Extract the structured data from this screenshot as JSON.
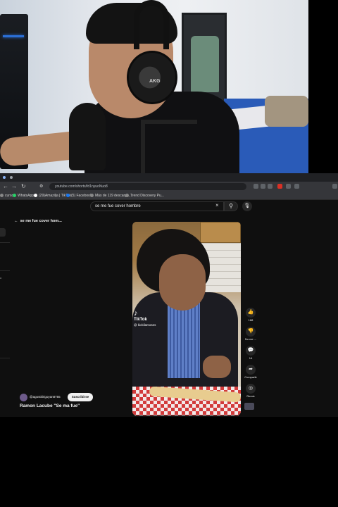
{
  "browser": {
    "url": "youtube.com/shorts/fd1nyuoNuo8",
    "bookmarks": [
      {
        "label": "cursos",
        "color": "#888888"
      },
      {
        "label": "WhatsApp",
        "color": "#25d366"
      },
      {
        "label": "(29)Amazilja | TikTok",
        "color": "#ffffff"
      },
      {
        "label": "(5) Facebook",
        "color": "#1877f2"
      },
      {
        "label": "Más de 119 descarga...",
        "color": "#888888"
      },
      {
        "label": "Trend Discovery Pu...",
        "color": "#888888"
      }
    ]
  },
  "youtube": {
    "search_value": "se me fue cover hombre",
    "back_title": "se me fue cover hom...",
    "left_edge_label": "o",
    "short": {
      "watermark": "TikTok",
      "handle": "@ kickilamoses"
    },
    "actions": [
      {
        "icon": "thumbs-up-icon",
        "glyph": "👍",
        "label": "188"
      },
      {
        "icon": "thumbs-down-icon",
        "glyph": "👎",
        "label": "No me ..."
      },
      {
        "icon": "comment-icon",
        "glyph": "💬",
        "label": "14"
      },
      {
        "icon": "share-icon",
        "glyph": "➦",
        "label": "Compartir"
      },
      {
        "icon": "remix-icon",
        "glyph": "◎",
        "label": "Remix"
      }
    ],
    "channel": {
      "name": "@agostitirigoyan8755",
      "subscribe_label": "Suscribirse"
    },
    "video_title": "Ramon Lacube \"Se ma fue\""
  },
  "webcam": {
    "headphone_brand": "AKG"
  },
  "colors": {
    "youtube_bg": "#0f0f0f",
    "bed_blue": "#2a5bb8",
    "tablecloth_red": "#d23a3a"
  }
}
